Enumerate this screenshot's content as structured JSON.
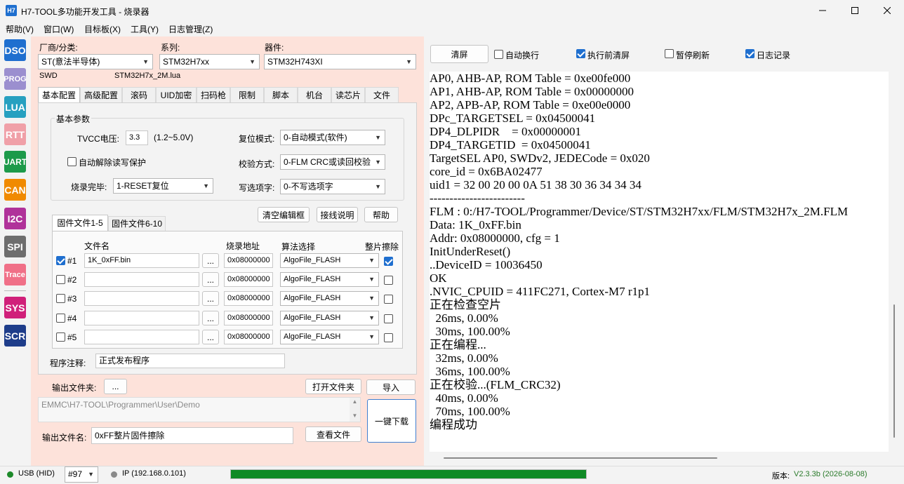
{
  "window": {
    "title": "H7-TOOL多功能开发工具 - 烧录器",
    "icon_text": "H7"
  },
  "menu": [
    "帮助(V)",
    "窗口(W)",
    "目标板(X)",
    "工具(Y)",
    "日志管理(Z)"
  ],
  "sidebar": [
    {
      "label": "DSO",
      "color": "#1f6fcf"
    },
    {
      "label": "PROG",
      "color": "#9b8fcf"
    },
    {
      "label": "LUA",
      "color": "#26a0c0"
    },
    {
      "label": "RTT",
      "color": "#f0a0a8"
    },
    {
      "label": "UART",
      "color": "#1d9a4a"
    },
    {
      "label": "CAN",
      "color": "#f08a00"
    },
    {
      "label": "I2C",
      "color": "#b0329a"
    },
    {
      "label": "SPI",
      "color": "#6e6e6e"
    },
    {
      "label": "Trace",
      "color": "#f07088"
    },
    {
      "label": "SYS",
      "color": "#d0207a"
    },
    {
      "label": "SCR",
      "color": "#1e3d8a"
    }
  ],
  "device": {
    "vendor_label": "厂商/分类:",
    "vendor_value": "ST(意法半导体)",
    "series_label": "系列:",
    "series_value": "STM32H7xx",
    "device_label": "器件:",
    "device_value": "STM32H743XI",
    "interface": "SWD",
    "script": "STM32H7x_2M.lua"
  },
  "tabs": [
    "基本配置",
    "高级配置",
    "滚码",
    "UID加密",
    "扫码枪",
    "限制",
    "脚本",
    "机台",
    "读芯片",
    "文件"
  ],
  "basic": {
    "group_title": "基本参数",
    "tvcc_label": "TVCC电压:",
    "tvcc_value": "3.3",
    "tvcc_range": "(1.2~5.0V)",
    "reset_label": "复位模式:",
    "reset_value": "0-自动模式(软件)",
    "unlock_label": "自动解除读写保护",
    "verify_label": "校验方式:",
    "verify_value": "0-FLM CRC或读回校验",
    "after_label": "烧录完毕:",
    "after_value": "1-RESET复位",
    "optbyte_label": "写选项字:",
    "optbyte_value": "0-不写选项字"
  },
  "buttons": {
    "clear_editor": "清空编辑框",
    "wiring": "接线说明",
    "help": "帮助"
  },
  "file_tabs": [
    "固件文件1-5",
    "固件文件6-10"
  ],
  "file_table": {
    "headers": [
      "文件名",
      "烧录地址",
      "算法选择",
      "整片擦除"
    ],
    "rows": [
      {
        "id": "#1",
        "checked": true,
        "file": "1K_0xFF.bin",
        "addr": "0x08000000",
        "algo": "AlgoFile_FLASH",
        "erase": true
      },
      {
        "id": "#2",
        "checked": false,
        "file": "",
        "addr": "0x08000000",
        "algo": "AlgoFile_FLASH",
        "erase": false
      },
      {
        "id": "#3",
        "checked": false,
        "file": "",
        "addr": "0x08000000",
        "algo": "AlgoFile_FLASH",
        "erase": false
      },
      {
        "id": "#4",
        "checked": false,
        "file": "",
        "addr": "0x08000000",
        "algo": "AlgoFile_FLASH",
        "erase": false
      },
      {
        "id": "#5",
        "checked": false,
        "file": "",
        "addr": "0x08000000",
        "algo": "AlgoFile_FLASH",
        "erase": false
      }
    ],
    "browse": "..."
  },
  "note": {
    "label": "程序注释:",
    "value": "正式发布程序"
  },
  "output": {
    "folder_label": "输出文件夹:",
    "browse": "...",
    "open_folder": "打开文件夹",
    "import": "导入",
    "path": "EMMC\\H7-TOOL\\Programmer\\User\\Demo",
    "download": "一键下载",
    "filename_label": "输出文件名:",
    "filename_value": "0xFF整片固件擦除",
    "view_file": "查看文件"
  },
  "log_toolbar": {
    "clear": "清屏",
    "autowrap": "自动换行",
    "autowrap_on": false,
    "clear_before": "执行前清屏",
    "clear_before_on": true,
    "pause": "暂停刷新",
    "pause_on": false,
    "log": "日志记录",
    "log_on": true
  },
  "log_lines": [
    "AP0, AHB-AP, ROM Table = 0xe00fe000",
    "AP1, AHB-AP, ROM Table = 0x00000000",
    "AP2, APB-AP, ROM Table = 0xe00e0000",
    "DPc_TARGETSEL = 0x04500041",
    "DP4_DLPIDR    = 0x00000001",
    "DP4_TARGETID  = 0x04500041",
    "TargetSEL AP0, SWDv2, JEDECode = 0x020",
    "core_id = 0x6BA02477",
    "uid1 = 32 00 20 00 0A 51 38 30 36 34 34 34",
    "------------------------",
    "FLM : 0:/H7-TOOL/Programmer/Device/ST/STM32H7xx/FLM/STM32H7x_2M.FLM",
    "Data: 1K_0xFF.bin",
    "Addr: 0x08000000, cfg = 1",
    "InitUnderReset()",
    "..DeviceID = 10036450",
    "OK",
    ".NVIC_CPUID = 411FC271, Cortex-M7 r1p1",
    "正在检查空片",
    "  26ms, 0.00%",
    "  30ms, 100.00%",
    "正在编程...",
    "  32ms, 0.00%",
    "  36ms, 100.00%",
    "正在校验...(FLM_CRC32)",
    "  40ms, 0.00%",
    "  70ms, 100.00%",
    "编程成功"
  ],
  "status": {
    "usb": "USB (HID)",
    "port": "#97",
    "ip": "IP (192.168.0.101)",
    "progress": 1.0,
    "version_label": "版本:",
    "version_value": "V2.3.3b (2026-08-08)"
  }
}
